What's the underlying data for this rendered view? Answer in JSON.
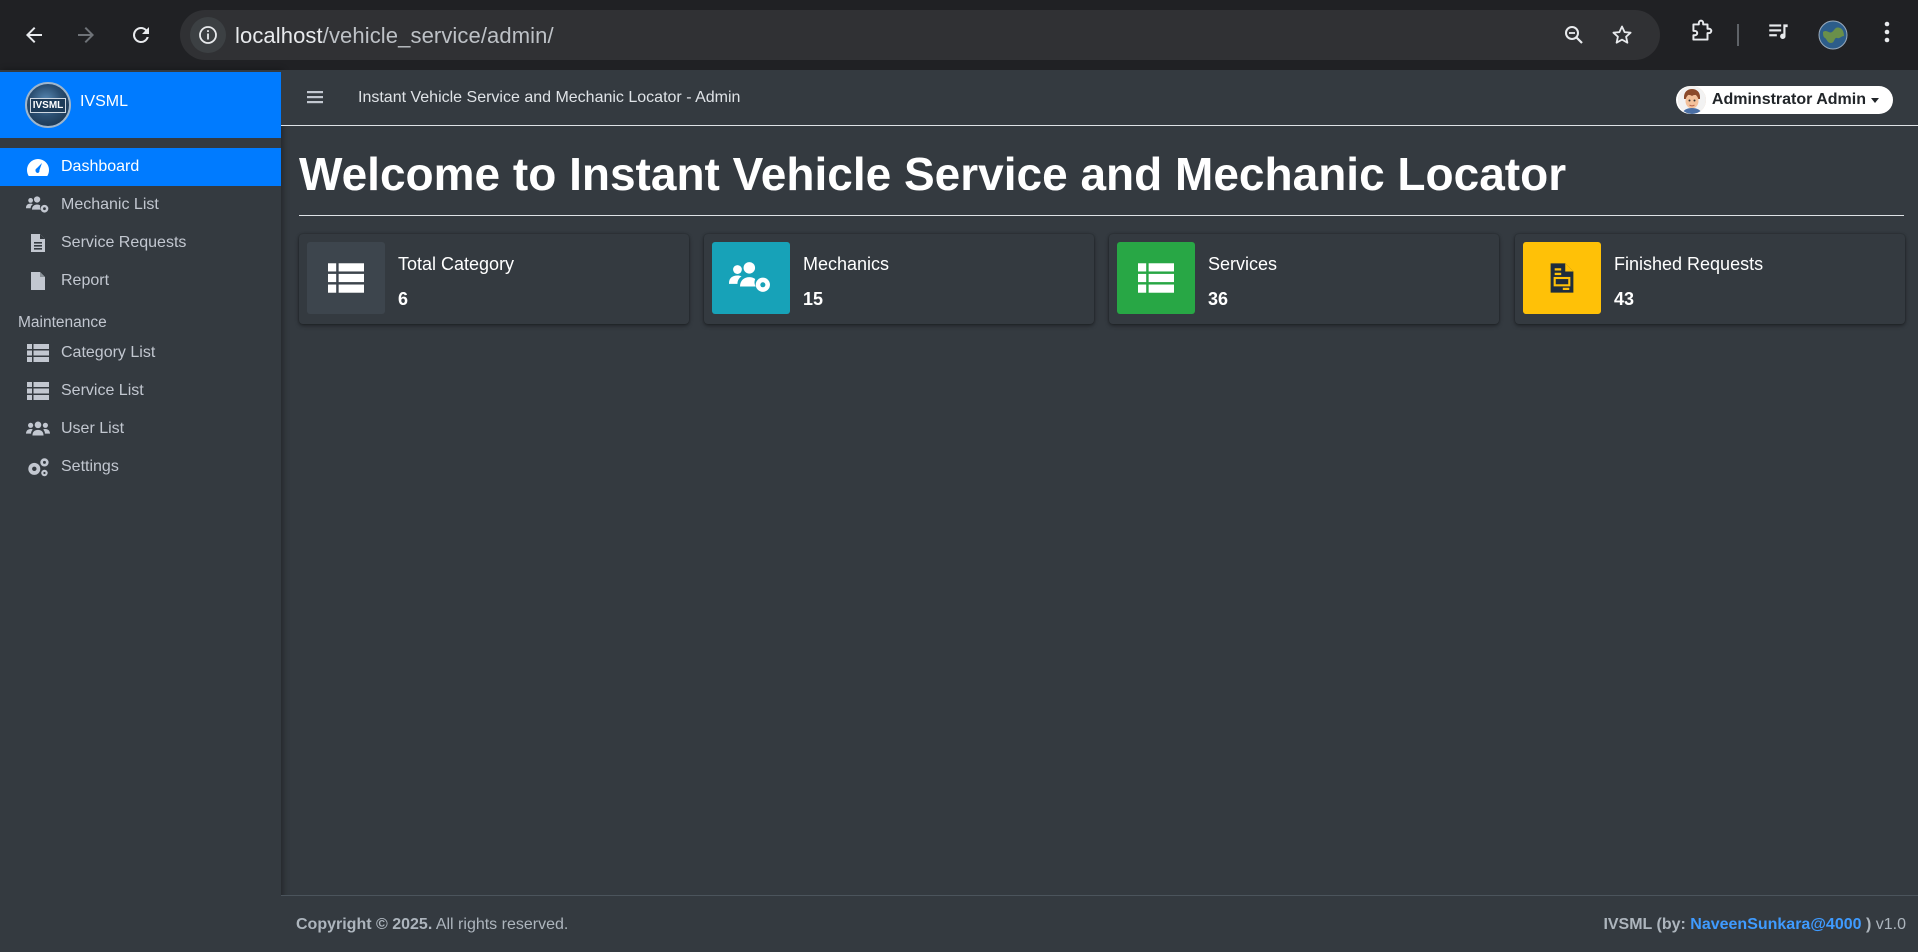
{
  "browser": {
    "url_host": "localhost",
    "url_path": "/vehicle_service/admin/"
  },
  "sidebar": {
    "brand": "IVSML",
    "logo_text": "IVSML",
    "items": [
      {
        "label": "Dashboard",
        "icon": "tachometer-icon",
        "active": true
      },
      {
        "label": "Mechanic List",
        "icon": "users-cog-icon"
      },
      {
        "label": "Service Requests",
        "icon": "file-alt-icon"
      },
      {
        "label": "Report",
        "icon": "file-icon"
      }
    ],
    "maintenance_header": "Maintenance",
    "maintenance_items": [
      {
        "label": "Category List",
        "icon": "th-list-icon"
      },
      {
        "label": "Service List",
        "icon": "th-list-icon"
      },
      {
        "label": "User List",
        "icon": "users-icon"
      },
      {
        "label": "Settings",
        "icon": "cogs-icon"
      }
    ]
  },
  "topnav": {
    "title": "Instant Vehicle Service and Mechanic Locator - Admin",
    "user": "Adminstrator Admin"
  },
  "main": {
    "heading": "Welcome to Instant Vehicle Service and Mechanic Locator",
    "cards": [
      {
        "label": "Total Category",
        "value": "6",
        "color": "#3d454d",
        "icon": "th-list-icon"
      },
      {
        "label": "Mechanics",
        "value": "15",
        "color": "#17a2b8",
        "icon": "users-cog-icon"
      },
      {
        "label": "Services",
        "value": "36",
        "color": "#28a745",
        "icon": "th-list-icon"
      },
      {
        "label": "Finished Requests",
        "value": "43",
        "color": "#ffc107",
        "icon": "file-invoice-icon"
      }
    ]
  },
  "footer": {
    "copyright_bold": "Copyright © 2025.",
    "copyright_rest": " All rights reserved.",
    "brand_prefix": "IVSML (by: ",
    "author": "NaveenSunkara@4000",
    "brand_suffix": " )",
    "version": " v1.0"
  },
  "colors": {
    "primary": "#007bff",
    "background": "#343a40"
  }
}
